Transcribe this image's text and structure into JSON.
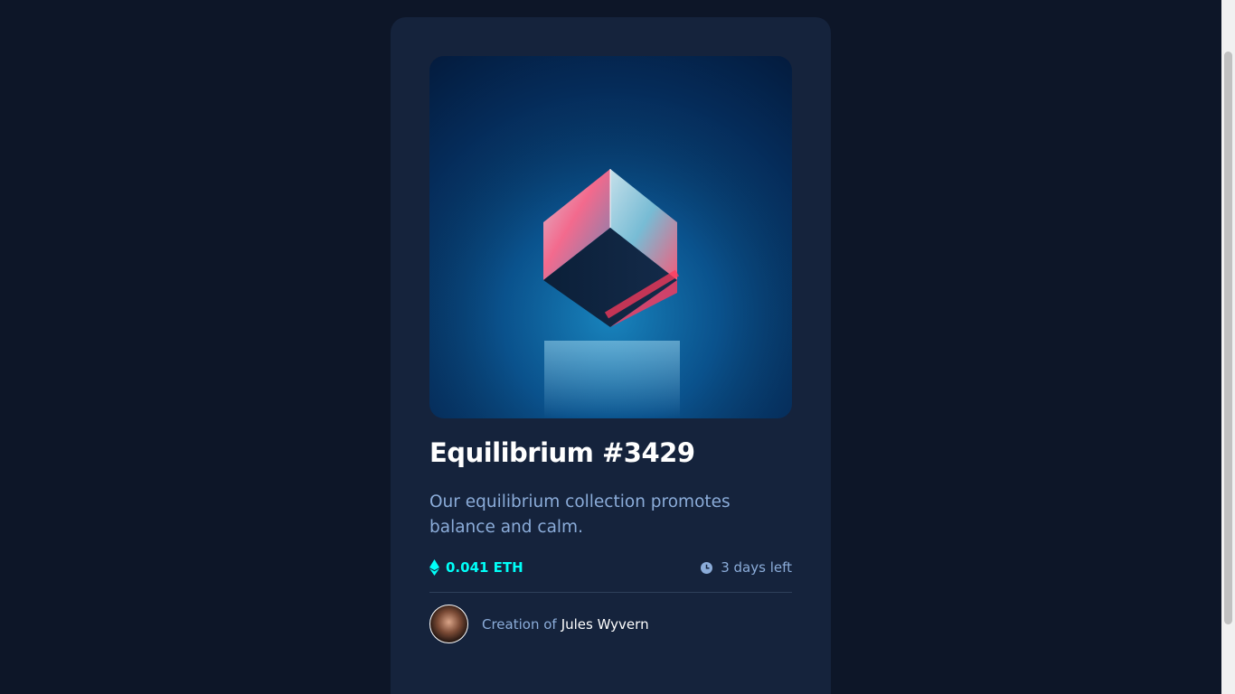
{
  "card": {
    "image_alt": "Equilibrium",
    "title": "Equilibrium #3429",
    "description": "Our equilibrium collection promotes balance and calm.",
    "price": "0.041 ETH",
    "time_left": "3 days left",
    "creator_prefix": "Creation of",
    "creator_name": "Jules Wyvern"
  },
  "icons": {
    "price": "ethereum-icon",
    "time": "clock-icon"
  },
  "colors": {
    "page_bg": "#0d1628",
    "card_bg": "#15233c",
    "accent": "#00fff8",
    "soft_blue": "#8bacd9",
    "white": "#ffffff"
  }
}
